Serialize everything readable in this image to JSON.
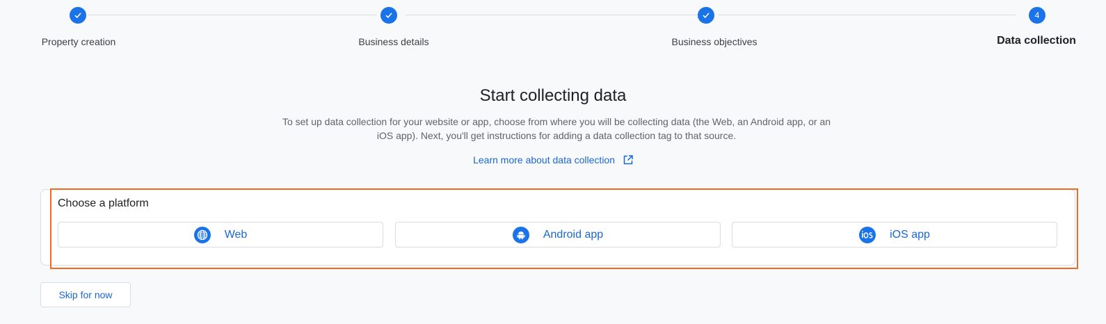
{
  "stepper": {
    "steps": [
      {
        "label": "Property creation",
        "marker": "✓"
      },
      {
        "label": "Business details",
        "marker": "✓"
      },
      {
        "label": "Business objectives",
        "marker": "✓"
      },
      {
        "label": "Data collection",
        "marker": "4"
      }
    ]
  },
  "main": {
    "title": "Start collecting data",
    "description": "To set up data collection for your website or app, choose from where you will be collecting data (the Web, an Android app, or an iOS app). Next, you'll get instructions for adding a data collection tag to that source.",
    "learn_more": "Learn more about data collection"
  },
  "platform": {
    "title": "Choose a platform",
    "options": [
      {
        "label": "Web",
        "icon": "globe-icon"
      },
      {
        "label": "Android app",
        "icon": "android-icon"
      },
      {
        "label": "iOS app",
        "icon": "ios-icon"
      }
    ]
  },
  "footer": {
    "skip_label": "Skip for now"
  },
  "colors": {
    "primary": "#1a73e8",
    "link": "#1967d2",
    "highlight": "#f26a21"
  }
}
